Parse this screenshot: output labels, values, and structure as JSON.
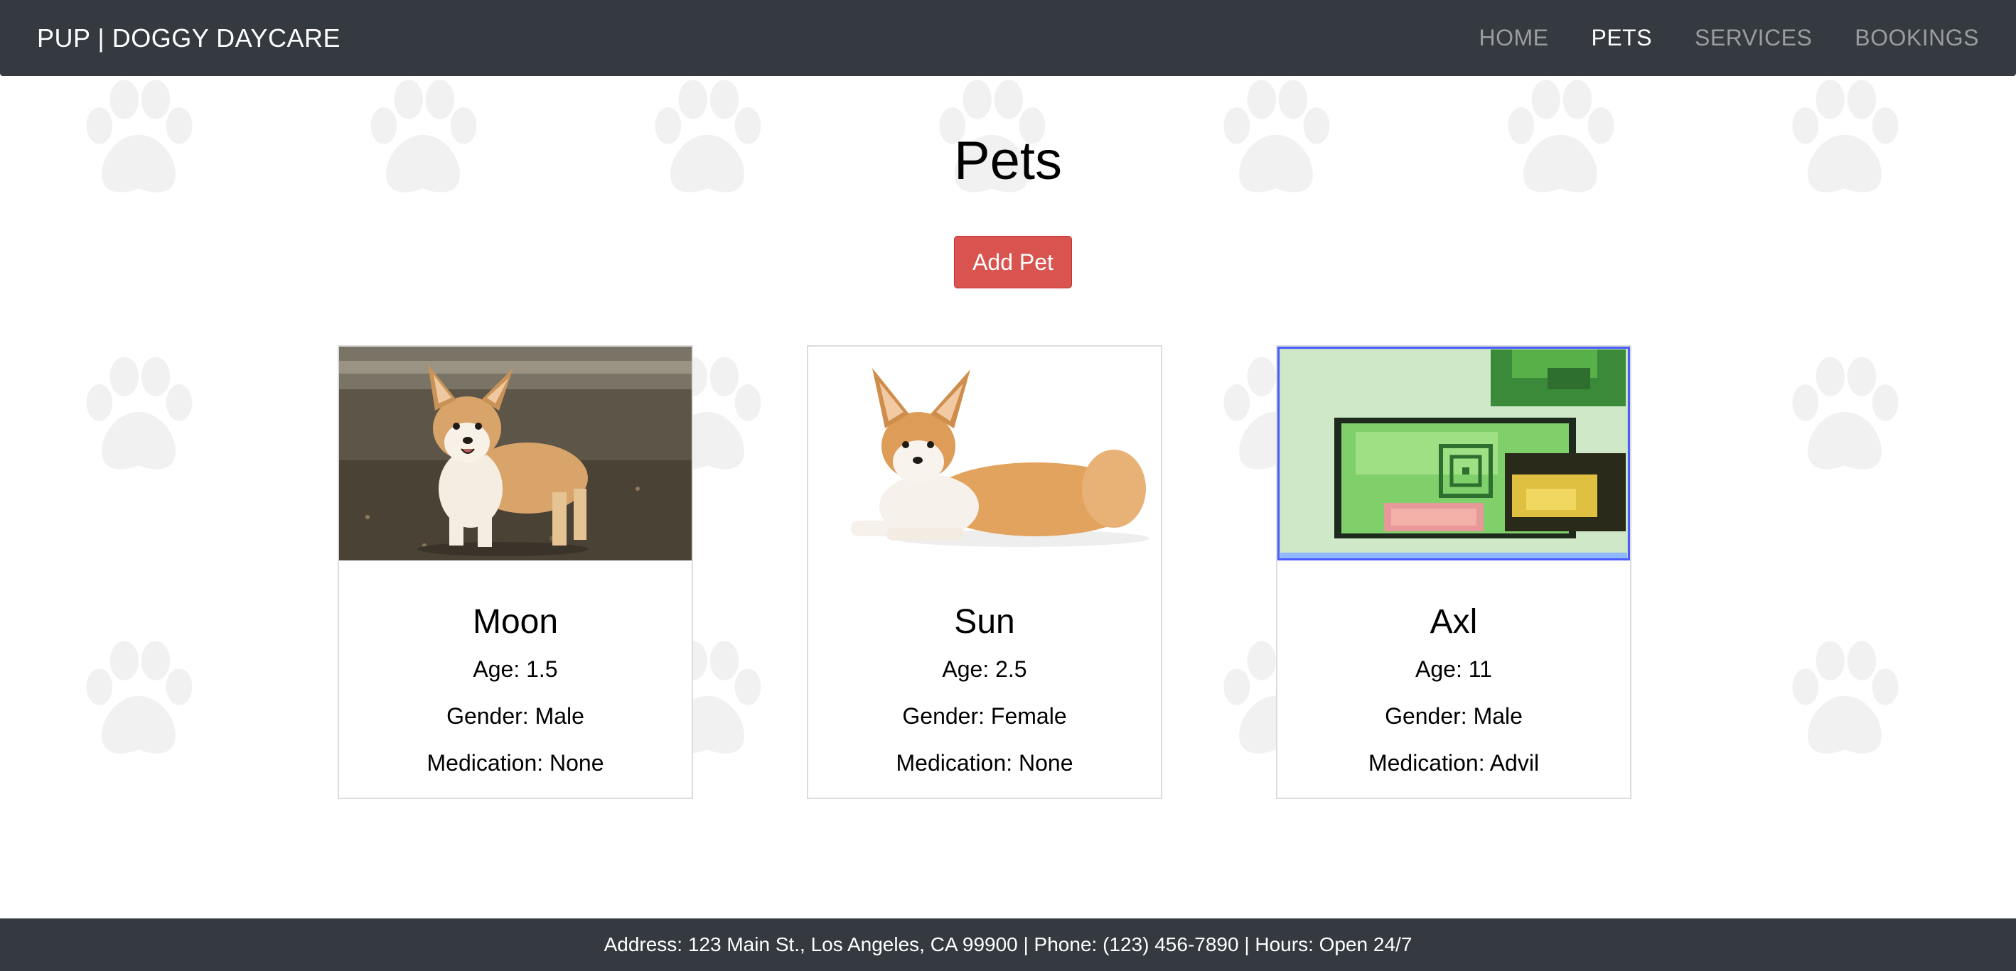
{
  "navbar": {
    "brand": "PUP | DOGGY DAYCARE",
    "links": [
      {
        "label": "HOME",
        "active": false
      },
      {
        "label": "PETS",
        "active": true
      },
      {
        "label": "SERVICES",
        "active": false
      },
      {
        "label": "BOOKINGS",
        "active": false
      }
    ]
  },
  "main": {
    "title": "Pets",
    "add_button_label": "Add Pet",
    "pets": [
      {
        "name": "Moon",
        "age": "Age: 1.5",
        "gender": "Gender: Male",
        "medication": "Medication: None",
        "image": "corgi-standing-photo"
      },
      {
        "name": "Sun",
        "age": "Age: 2.5",
        "gender": "Gender: Female",
        "medication": "Medication: None",
        "image": "corgi-lying-photo"
      },
      {
        "name": "Axl",
        "age": "Age: 11",
        "gender": "Gender: Male",
        "medication": "Medication: Advil",
        "image": "pixel-turtle-sprite"
      }
    ]
  },
  "footer": {
    "text": "Address: 123 Main St., Los Angeles, CA 99900 | Phone: (123) 456-7890 | Hours: Open 24/7"
  },
  "colors": {
    "navbar_bg": "#343a40",
    "nav_active": "#ffffff",
    "nav_inactive": "#9a9da0",
    "add_button": "#d9534f",
    "paw": "#f1f1f1"
  },
  "icons": {
    "background_pattern": "paw-print-icon"
  }
}
